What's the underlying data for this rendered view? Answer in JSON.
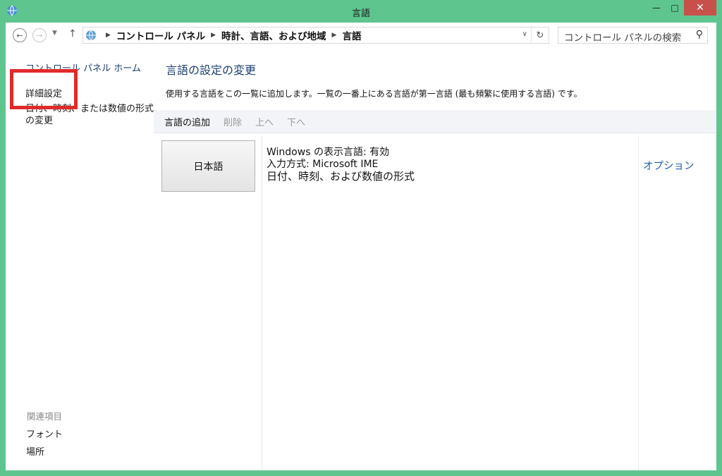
{
  "window": {
    "title": "言語",
    "minimize": "—",
    "maximize": "□",
    "close": "✕"
  },
  "address_bar": {
    "breadcrumbs": [
      "コントロール パネル",
      "時計、言語、および地域",
      "言語"
    ],
    "search_placeholder": "コントロール パネルの検索"
  },
  "sidebar": {
    "home": "コントロール パネル ホーム",
    "advanced": "詳細設定",
    "format_change": "日付、時刻、または数値の形式の変更",
    "related_header": "関連項目",
    "related": [
      "フォント",
      "場所"
    ]
  },
  "main": {
    "heading": "言語の設定の変更",
    "description": "使用する言語をこの一覧に追加します。一覧の一番上にある言語が第一言語 (最も頻繁に使用する言語) です。",
    "toolbar": {
      "add": "言語の追加",
      "remove": "削除",
      "up": "上へ",
      "down": "下へ"
    },
    "languages": [
      {
        "name": "日本語",
        "display_language": "Windows の表示言語: 有効",
        "input_method": "入力方式: Microsoft IME",
        "formats": "日付、時刻、および数値の形式",
        "options": "オプション"
      }
    ]
  },
  "colors": {
    "frame": "#5ec58f",
    "close": "#c7504b",
    "link": "#1e3f73",
    "highlight": "#e02b2b"
  },
  "icons": [
    "app-globe-icon",
    "back-arrow-icon",
    "forward-arrow-icon",
    "recent-dropdown-icon",
    "up-arrow-icon",
    "globe-icon",
    "refresh-icon",
    "search-icon"
  ]
}
